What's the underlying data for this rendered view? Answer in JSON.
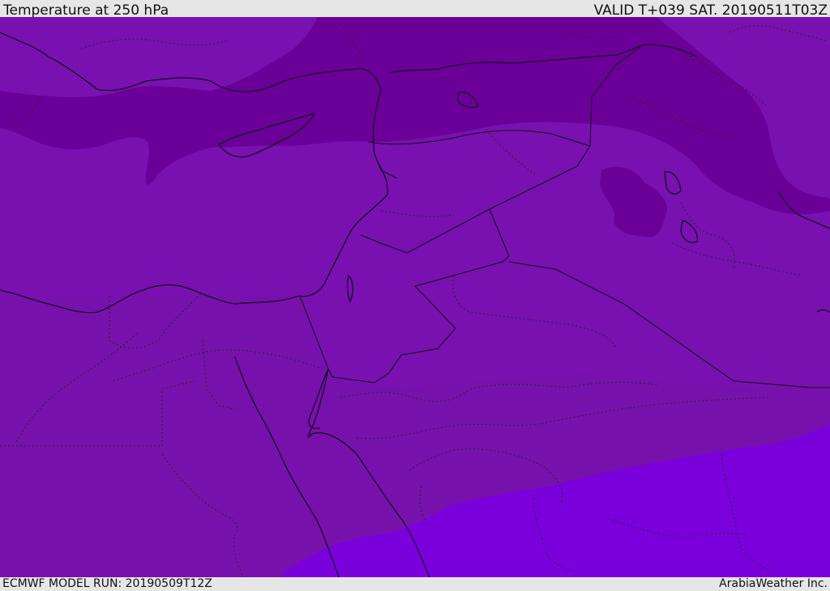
{
  "header": {
    "title": "Temperature at 250 hPa",
    "valid_time": "VALID T+039 SAT. 20190511T03Z"
  },
  "footer": {
    "model_run": "ECMWF MODEL RUN: 20190509T12Z",
    "credit": "ArabiaWeather Inc."
  },
  "map": {
    "variable": "temperature",
    "pressure_level": "250 hPa",
    "colors": {
      "cold_band": "#6b0099",
      "mid_band": "#7811b0",
      "warm_band": "#7a00dc",
      "coastline": "#000000",
      "border": "#222222"
    }
  }
}
